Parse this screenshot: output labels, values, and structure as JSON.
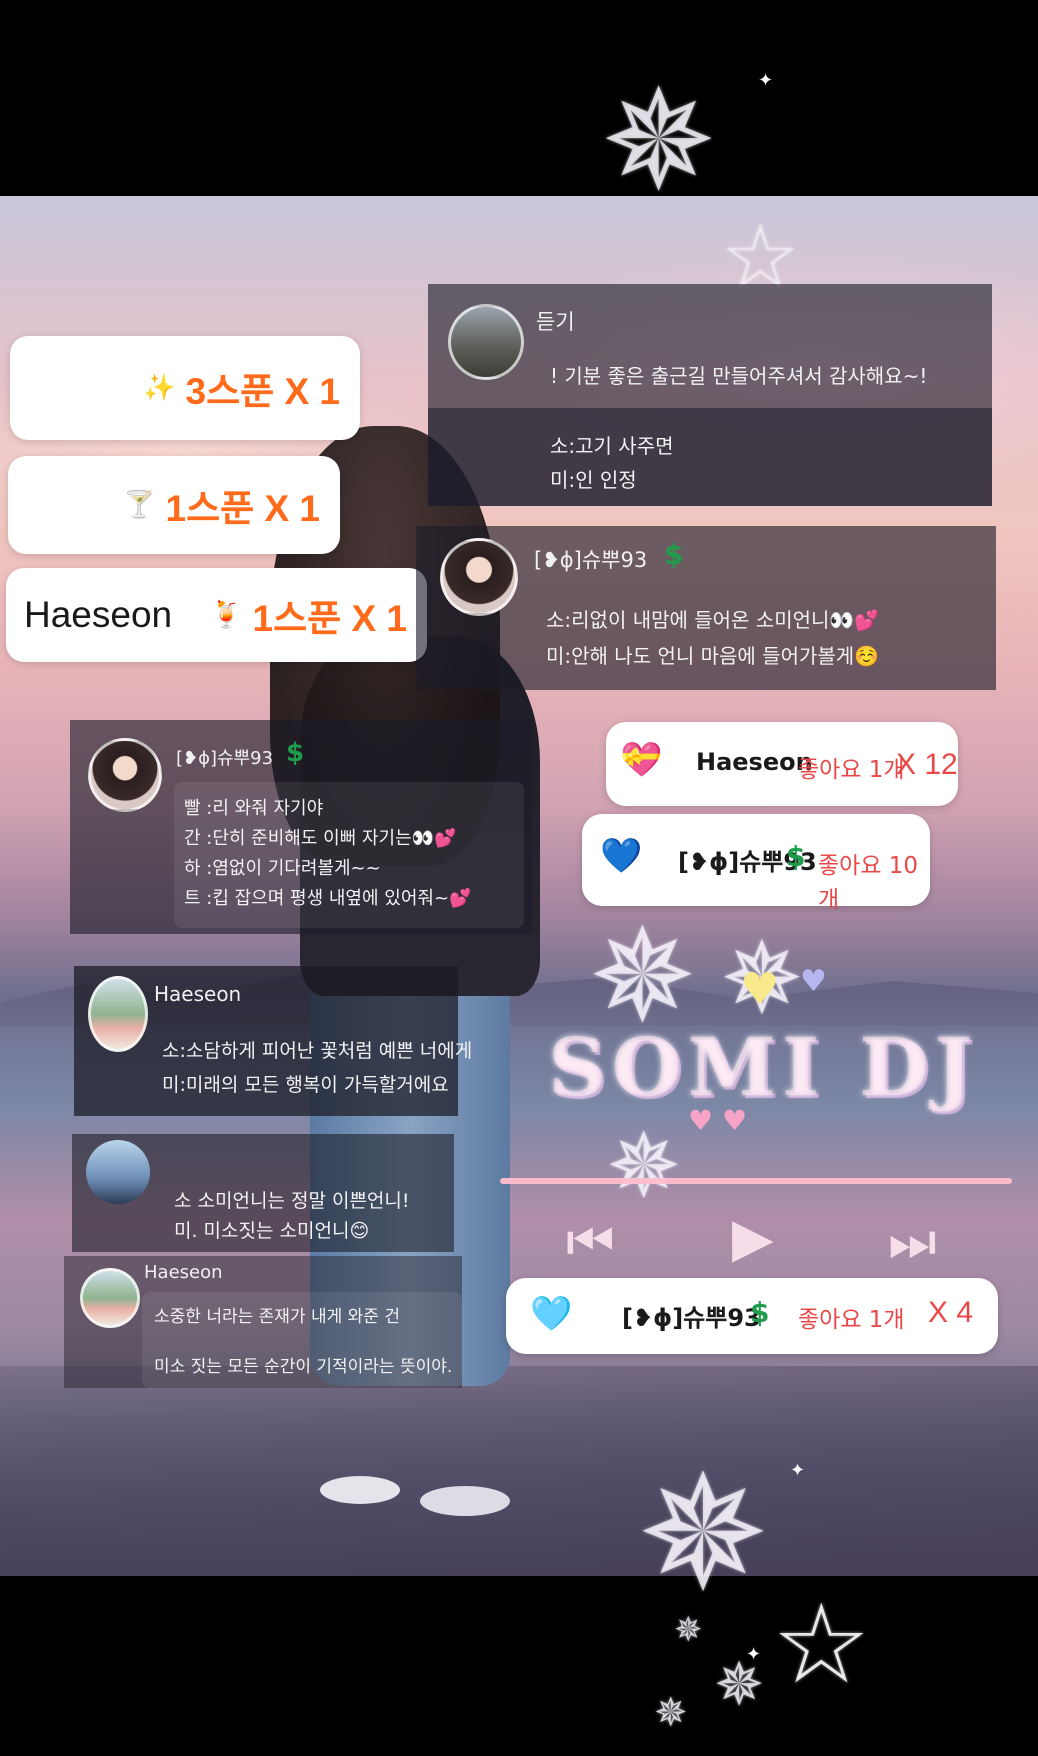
{
  "gifts": [
    {
      "user": "",
      "icon": "sparkle-stars-icon",
      "icon_char": "✨",
      "amount": "3스푼 X 1"
    },
    {
      "user": "",
      "icon": "cocktail-icon",
      "icon_char": "🍸",
      "amount": "1스푼 X 1"
    },
    {
      "user": "Haeseon",
      "icon": "tropical-drink-icon",
      "icon_char": "🍹",
      "amount": "1스푼 X 1"
    }
  ],
  "chat": [
    {
      "nick": "듣기",
      "lines": [
        "! 기분 좋은 출근길 만들어주셔서 감사해요~!"
      ],
      "sub": [
        "소:고기 사주면",
        "미:인 인정"
      ]
    },
    {
      "nick": "[❥ϕ]슈뿌93",
      "badge": "$",
      "lines": [
        "소:리없이 내맘에 들어온 소미언니👀💕",
        "미:안해 나도 언니 마음에 들어가볼게☺️"
      ]
    },
    {
      "nick": "[❥ϕ]슈뿌93",
      "badge": "$",
      "lines": [
        "빨 :리 와줘 자기야",
        "간 :단히 준비해도 이뻐 자기는👀💕",
        "하 :염없이 기다려볼게~~",
        "트 :킵 잡으며 평생 내옆에 있어줘~💕"
      ]
    },
    {
      "nick": "Haeseon",
      "lines": [
        "소:소담하게 피어난 꽃처럼 예쁜 너에게",
        "미:미래의 모든 행복이 가득할거에요"
      ]
    },
    {
      "nick": "",
      "lines": [
        "소 소미언니는 정말 이쁜언니!",
        "미. 미소짓는 소미언니😊"
      ]
    },
    {
      "nick": "Haeseon",
      "lines": [
        "소중한 너라는 존재가 내게 와준 건",
        "미소 짓는 모든 순간이 기적이라는 뜻이야."
      ]
    }
  ],
  "likes": [
    {
      "icon_char": "💝",
      "user": "Haeseon",
      "label": "좋아요 1개",
      "count": "X 12"
    },
    {
      "icon_char": "💙",
      "user": "[❥ϕ]슈뿌93",
      "dollar": "$",
      "label": "좋아요 10개",
      "count": ""
    },
    {
      "icon_char": "🩵",
      "user": "[❥ϕ]슈뿌93",
      "dollar": "$",
      "label": "좋아요 1개",
      "count": "X 4"
    }
  ],
  "dj": {
    "title": "SOMI DJ",
    "prev": "⏮",
    "play": "▶",
    "next": "⏭"
  },
  "colors": {
    "gift_orange": "#ff6b1a",
    "like_red": "#e84848",
    "dollar_green": "#1f9d4c"
  }
}
